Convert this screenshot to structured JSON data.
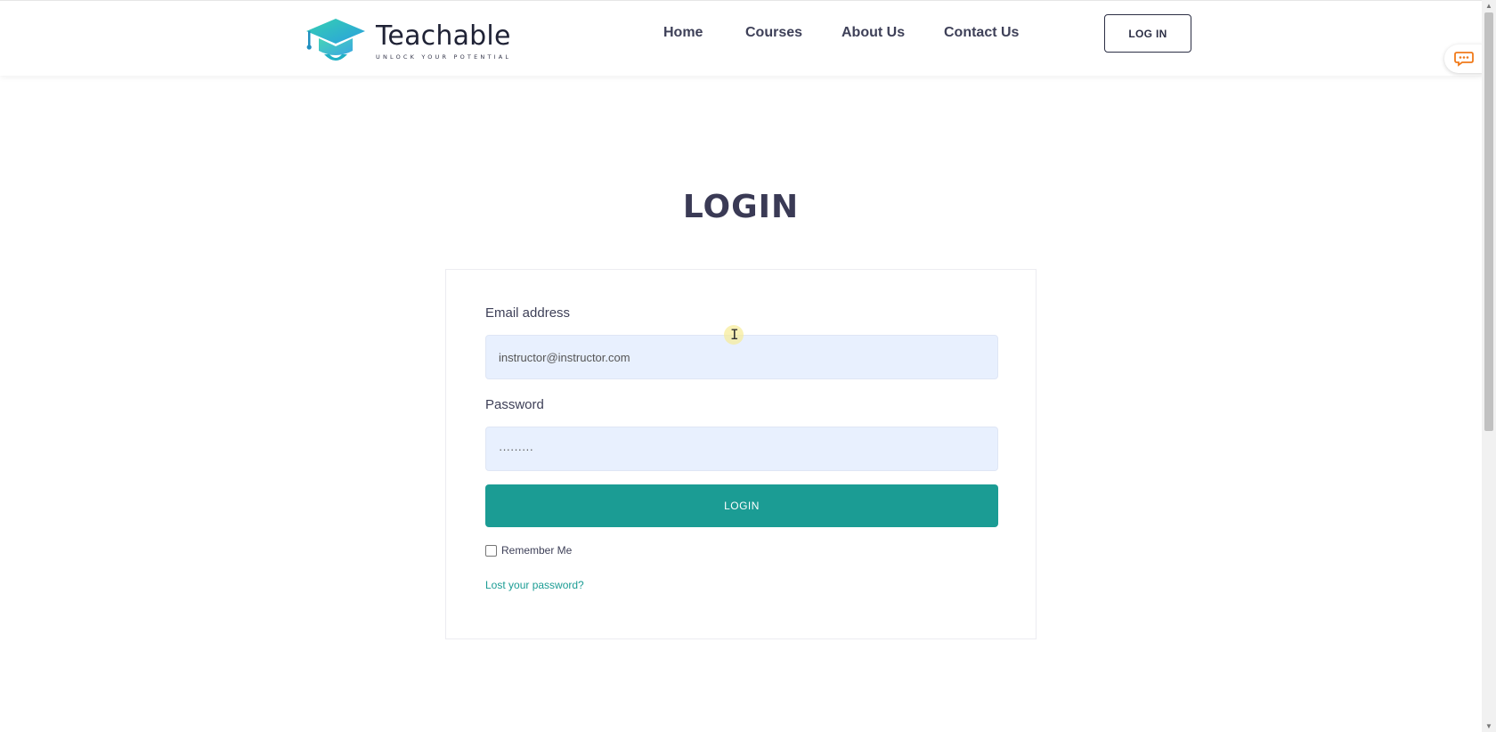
{
  "brand": {
    "name": "Teachable",
    "tagline": "UNLOCK YOUR POTENTIAL",
    "logo_icon": "graduation-cap-icon",
    "colors": {
      "gradient_start": "#2ec4b6",
      "gradient_end": "#2aa5e0"
    }
  },
  "nav": {
    "links": [
      "Home",
      "Courses",
      "About Us",
      "Contact Us"
    ],
    "login_button": "LOG IN"
  },
  "chat": {
    "icon": "chat-bubble-icon",
    "color": "#f07a1a"
  },
  "login": {
    "title": "LOGIN",
    "email_label": "Email address",
    "email_value": "instructor@instructor.com",
    "password_label": "Password",
    "password_value": "·········",
    "submit_label": "LOGIN",
    "remember_label": "Remember Me",
    "remember_checked": false,
    "lost_password": "Lost your password?"
  },
  "colors": {
    "accent": "#1b9c94",
    "input_bg": "#e8f0fe",
    "heading": "#3a3a55"
  }
}
